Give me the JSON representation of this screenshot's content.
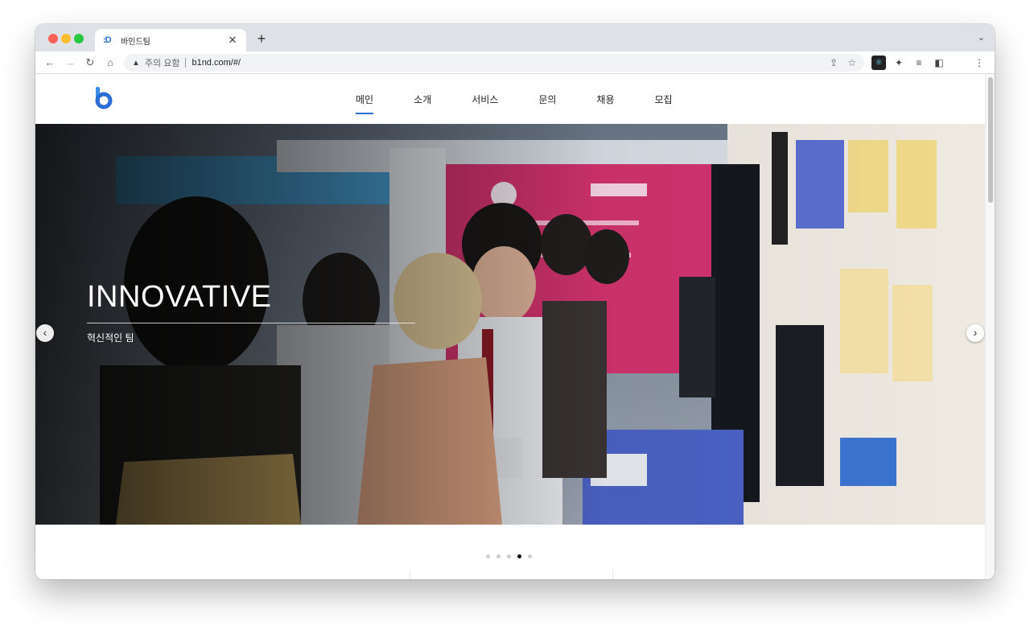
{
  "browser": {
    "tab": {
      "favicon": ":D",
      "title": "바인드팀",
      "close": "✕"
    },
    "new_tab": "+",
    "tab_menu": "⌄",
    "nav": {
      "back": "←",
      "forward": "→",
      "reload": "↻",
      "home": "⌂"
    },
    "omnibox": {
      "warning_icon": "▲",
      "warning_label": "주의 요함",
      "url": "b1nd.com/#/",
      "share_icon": "⇪",
      "bookmark_icon": "☆"
    },
    "extensions": {
      "react": "⚛",
      "puzzle": "✦",
      "media": "≡",
      "sidepanel": "◧",
      "menu": "⋮"
    }
  },
  "site": {
    "nav": [
      "메인",
      "소개",
      "서비스",
      "문의",
      "채용",
      "모집"
    ],
    "active_nav": 0,
    "hero": {
      "title": "INNOVATIVE",
      "subtitle": "혁신적인 팀",
      "prev_arrow": "‹",
      "next_arrow": "›"
    },
    "carousel": {
      "total": 5,
      "active": 3
    }
  },
  "colors": {
    "accent": "#2d6fd1",
    "tab_bg": "#dee1e6"
  }
}
